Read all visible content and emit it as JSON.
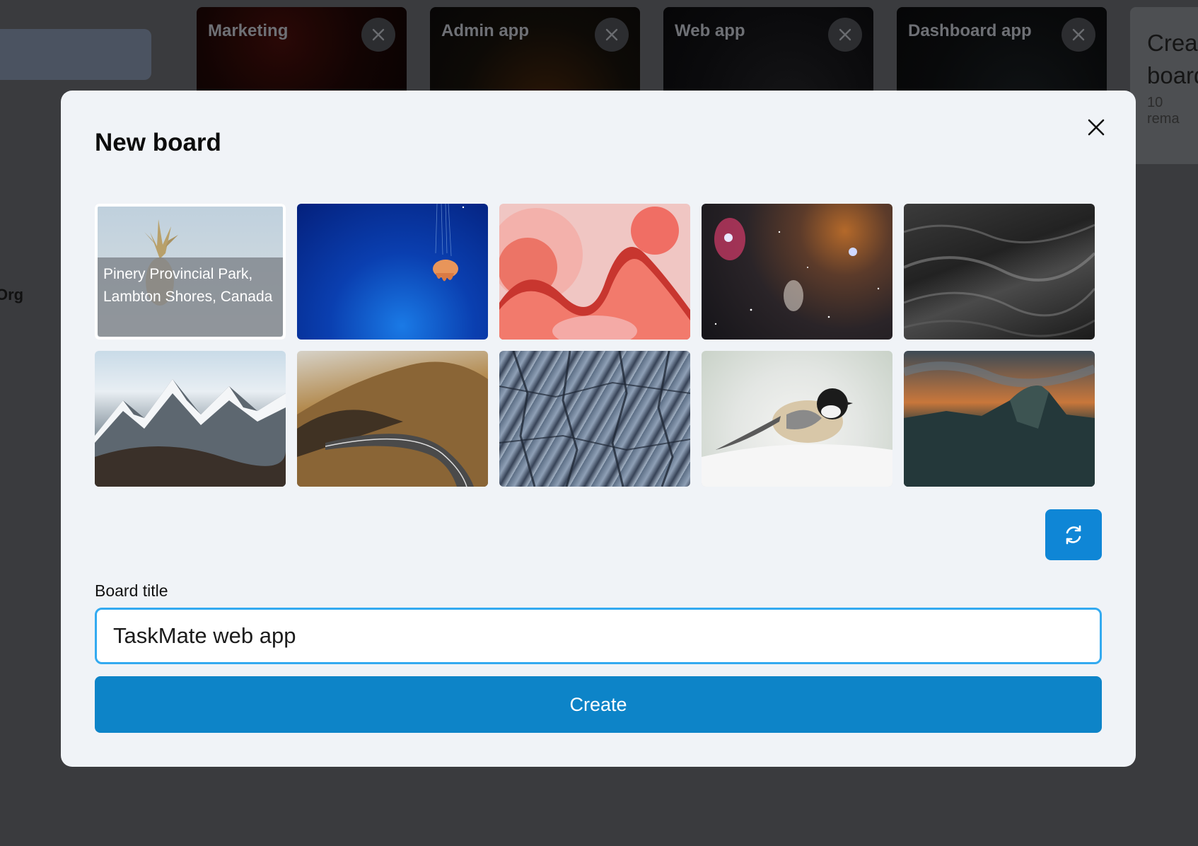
{
  "background": {
    "org_label": "Org",
    "boards": [
      {
        "title": "Marketing"
      },
      {
        "title": "Admin app"
      },
      {
        "title": "Web app"
      },
      {
        "title": "Dashboard app"
      }
    ],
    "create_card": {
      "title_line1": "Creat",
      "title_line2": "board",
      "subtitle": "10 rema"
    }
  },
  "modal": {
    "title": "New board",
    "close_icon": "close-icon",
    "images": [
      {
        "name": "pineapple-image",
        "caption": "Pinery Provincial Park, Lambton Shores, Canada",
        "selected": true
      },
      {
        "name": "jellyfish-image"
      },
      {
        "name": "coral-shapes-image"
      },
      {
        "name": "galaxy-image"
      },
      {
        "name": "ocean-waves-image"
      },
      {
        "name": "snowy-mountains-image"
      },
      {
        "name": "mountain-road-image"
      },
      {
        "name": "glacier-ice-image"
      },
      {
        "name": "chickadee-bird-image"
      },
      {
        "name": "half-dome-sunset-image"
      }
    ],
    "refresh_icon": "refresh-icon",
    "field_label": "Board title",
    "title_value": "TaskMate web app",
    "create_label": "Create"
  },
  "colors": {
    "accent": "#0d84c8",
    "focus_border": "#33aaf0",
    "modal_bg": "#f0f3f7",
    "overlay": "#3a3b3e"
  }
}
